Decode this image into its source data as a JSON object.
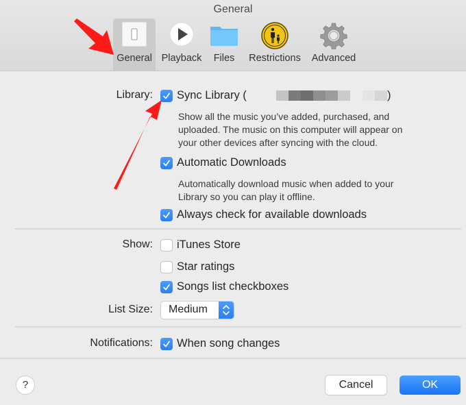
{
  "window": {
    "title": "General"
  },
  "toolbar": {
    "items": [
      {
        "label": "General",
        "icon": "switch-icon",
        "selected": true
      },
      {
        "label": "Playback",
        "icon": "play-icon",
        "selected": false
      },
      {
        "label": "Files",
        "icon": "folder-icon",
        "selected": false
      },
      {
        "label": "Restrictions",
        "icon": "parental-controls-icon",
        "selected": false
      },
      {
        "label": "Advanced",
        "icon": "gear-icon",
        "selected": false
      }
    ]
  },
  "library": {
    "label": "Library:",
    "sync_library": {
      "label": "Sync Library (",
      "label_close": ")",
      "account": "[redacted]",
      "checked": true,
      "description": "Show all the music you’ve added, purchased, and\nuploaded. The music on this computer will appear on\nyour other devices after syncing with the cloud."
    },
    "automatic_downloads": {
      "label": "Automatic Downloads",
      "checked": true,
      "description": "Automatically download music when added to your\nLibrary so you can play it offline."
    },
    "always_check": {
      "label": "Always check for available downloads",
      "checked": true
    }
  },
  "show": {
    "label": "Show:",
    "itunes_store": {
      "label": "iTunes Store",
      "checked": false
    },
    "star_ratings": {
      "label": "Star ratings",
      "checked": false
    },
    "songs_list_checkboxes": {
      "label": "Songs list checkboxes",
      "checked": true
    }
  },
  "list_size": {
    "label": "List Size:",
    "value": "Medium"
  },
  "notifications": {
    "label": "Notifications:",
    "when_song_changes": {
      "label": "When song changes",
      "checked": true
    }
  },
  "footer": {
    "help": "?",
    "cancel": "Cancel",
    "ok": "OK"
  },
  "colors": {
    "accent": "#2d7ef0",
    "annotation": "#ff0000",
    "background": "#ececec"
  }
}
